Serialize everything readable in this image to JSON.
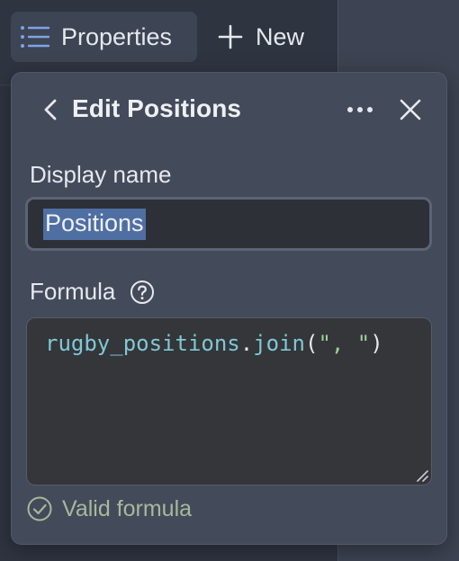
{
  "toolbar": {
    "properties_label": "Properties",
    "new_label": "New"
  },
  "panel": {
    "title": "Edit Positions",
    "display_name": {
      "label": "Display name",
      "value": "Positions"
    },
    "formula": {
      "label": "Formula",
      "code": {
        "ident1": "rugby_positions",
        "dot": ".",
        "method": "join",
        "paren_open": "(",
        "string": "\", \"",
        "paren_close": ")"
      }
    },
    "status": {
      "text": "Valid formula",
      "color": "#a7b99a"
    }
  },
  "colors": {
    "panel_bg": "#434a5a",
    "selection": "#4f6fa3",
    "code_identifier": "#7fc8d6",
    "code_string": "#9ed09a"
  }
}
